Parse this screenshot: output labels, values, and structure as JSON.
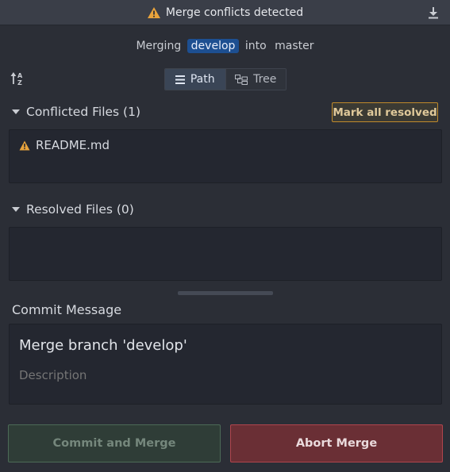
{
  "header": {
    "title": "Merge conflicts detected",
    "warning_color": "#e8a33c",
    "download_icon": "download-icon"
  },
  "merge_info": {
    "prefix": "Merging",
    "source_branch": "develop",
    "connector": "into",
    "target_branch": "master"
  },
  "view_toggle": {
    "path_label": "Path",
    "tree_label": "Tree",
    "active": "Path"
  },
  "conflicted": {
    "title": "Conflicted Files (1)",
    "mark_all_label": "Mark all resolved",
    "files": [
      {
        "name": "README.md",
        "icon": "warning-icon"
      }
    ]
  },
  "resolved": {
    "title": "Resolved Files (0)",
    "files": []
  },
  "commit": {
    "label": "Commit Message",
    "summary_value": "Merge branch 'develop'",
    "description_placeholder": "Description"
  },
  "actions": {
    "commit_label": "Commit and Merge",
    "abort_label": "Abort Merge"
  }
}
